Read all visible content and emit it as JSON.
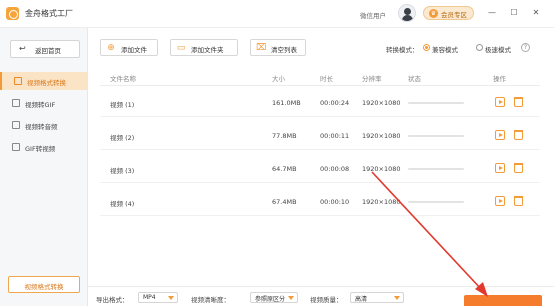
{
  "app": {
    "title": "金舟格式工厂",
    "user": "微信用户",
    "vip_label": "会员专区"
  },
  "window_controls": [
    "—",
    "☐",
    "✕"
  ],
  "sidebar": {
    "back_label": "返回首页",
    "items": [
      {
        "label": "视频格式转换",
        "active": true
      },
      {
        "label": "视频转GIF",
        "active": false
      },
      {
        "label": "视频转音频",
        "active": false
      },
      {
        "label": "GIF转视频",
        "active": false
      }
    ],
    "promo_label": "视频格式转换"
  },
  "toolbar": {
    "add_file": "添加文件",
    "add_folder": "添加文件夹",
    "clear_list": "清空列表",
    "mode_label": "转换模式：",
    "mode_compat": "兼容模式",
    "mode_fast": "极速模式",
    "selected_mode": "compat"
  },
  "table": {
    "headers": {
      "name": "文件名称",
      "size": "大小",
      "duration": "时长",
      "resolution": "分辨率",
      "status": "状态",
      "actions": "操作"
    },
    "rows": [
      {
        "name": "视频 (1)",
        "size": "161.0MB",
        "duration": "00:00:24",
        "resolution": "1920×1080",
        "progress": 0
      },
      {
        "name": "视频 (2)",
        "size": "77.8MB",
        "duration": "00:00:11",
        "resolution": "1920×1080",
        "progress": 0
      },
      {
        "name": "视频 (3)",
        "size": "64.7MB",
        "duration": "00:00:08",
        "resolution": "1920×1080",
        "progress": 0
      },
      {
        "name": "视频 (4)",
        "size": "67.4MB",
        "duration": "00:00:10",
        "resolution": "1920×1080",
        "progress": 0
      }
    ]
  },
  "bottom": {
    "format_label": "导出格式：",
    "format_value": "MP4",
    "clarity_label": "视频清晰度：",
    "clarity_value": "参照原区分",
    "quality_label": "视频质量：",
    "quality_value": "高清"
  },
  "colors": {
    "accent": "#f29b38",
    "convert": "#f47c2c",
    "arrow": "#e03a2f"
  }
}
